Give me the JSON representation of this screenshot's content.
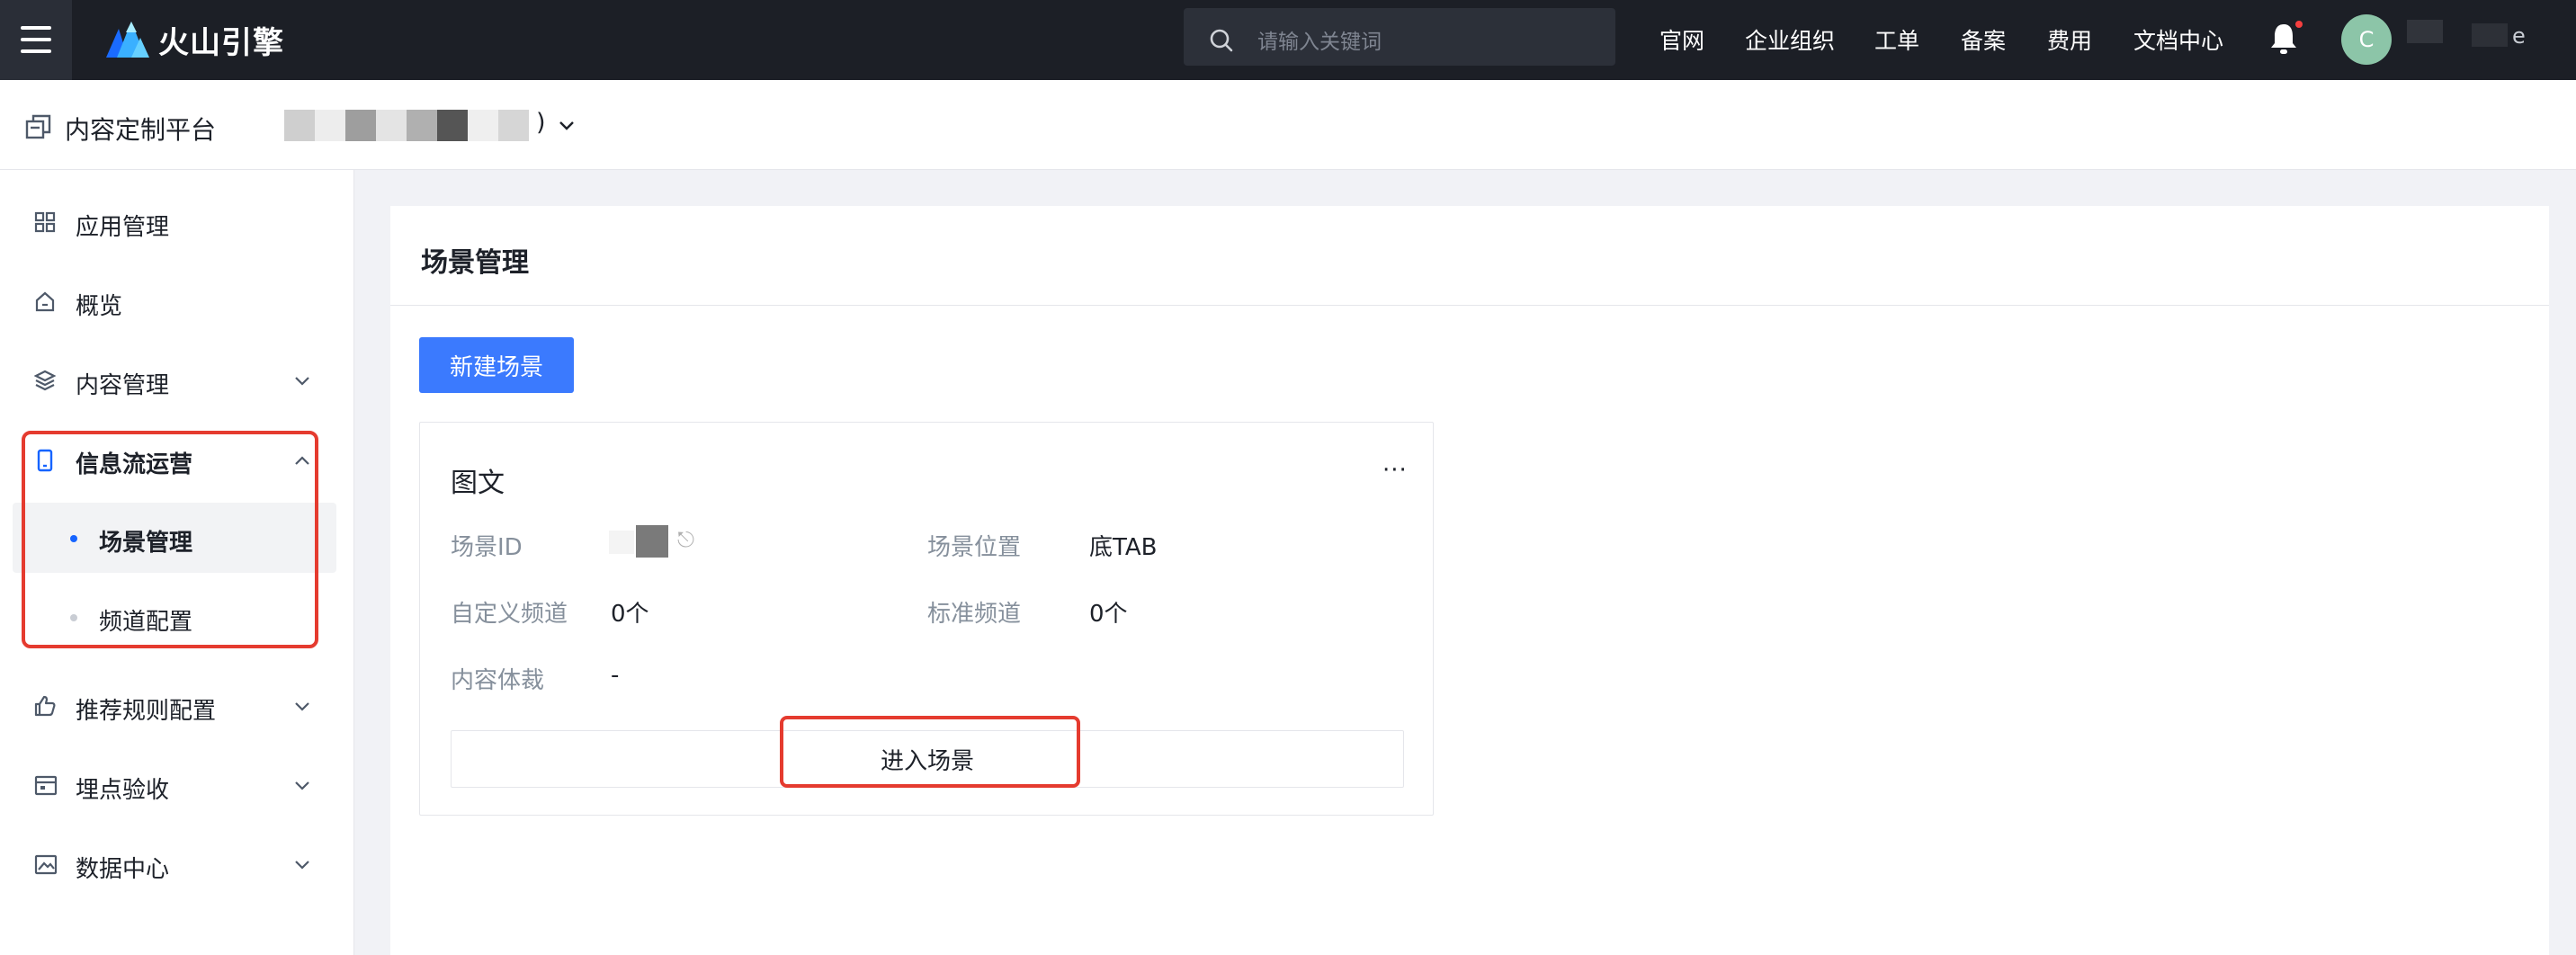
{
  "topbar": {
    "brand": "火山引擎",
    "search_placeholder": "请输入关键词",
    "links": [
      "官网",
      "企业组织",
      "工单",
      "备案",
      "费用",
      "文档中心"
    ],
    "avatar_letter": "C",
    "user_suffix": "e"
  },
  "subbar": {
    "platform_name": "内容定制平台",
    "project_suffix": ")"
  },
  "sidebar": {
    "items": [
      {
        "label": "应用管理",
        "icon": "grid-icon"
      },
      {
        "label": "概览",
        "icon": "home-icon"
      },
      {
        "label": "内容管理",
        "icon": "layers-icon"
      },
      {
        "label": "信息流运营",
        "icon": "phone-icon"
      },
      {
        "label": "推荐规则配置",
        "icon": "thumbs-up-icon"
      },
      {
        "label": "埋点验收",
        "icon": "calendar-icon"
      },
      {
        "label": "数据中心",
        "icon": "image-icon"
      }
    ],
    "sub_items": [
      {
        "label": "场景管理",
        "active": true
      },
      {
        "label": "频道配置",
        "active": false
      }
    ]
  },
  "main": {
    "title": "场景管理",
    "new_button": "新建场景",
    "card": {
      "title": "图文",
      "more": "···",
      "scene_id_label": "场景ID",
      "scene_position_label": "场景位置",
      "scene_position_value": "底TAB",
      "custom_channel_label": "自定义频道",
      "custom_channel_value": "0个",
      "standard_channel_label": "标准频道",
      "standard_channel_value": "0个",
      "content_genre_label": "内容体裁",
      "content_genre_value": "-",
      "enter_button": "进入场景"
    }
  },
  "colors": {
    "primary": "#3b7afe",
    "highlight_red": "#e53b2f",
    "topbar_bg": "#1c1f26"
  }
}
